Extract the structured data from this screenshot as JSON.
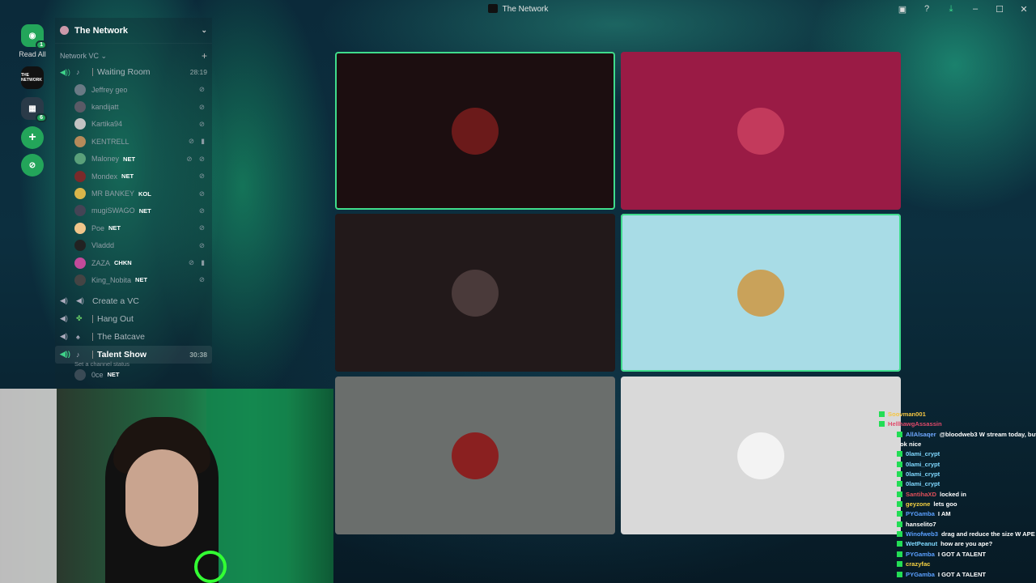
{
  "window": {
    "title": "The Network",
    "icons": [
      "pip-icon",
      "help-icon",
      "download-icon",
      "minimize-icon",
      "maximize-icon",
      "close-icon"
    ]
  },
  "rail": {
    "read_all": "Read All",
    "guild_badge": "1",
    "folder_badge": "6",
    "server_initials": "THE NETWORK"
  },
  "server": {
    "name": "The Network"
  },
  "category": {
    "name": "Network VC"
  },
  "channels": [
    {
      "name": "Waiting Room",
      "time": "28:19",
      "active": false
    },
    {
      "name": "Create a VC"
    },
    {
      "name": "Hang Out"
    },
    {
      "name": "The Batcave"
    },
    {
      "name": "Talent Show",
      "time": "30:38",
      "status": "Set a channel status"
    }
  ],
  "members": [
    {
      "name": "Jeffrey geo",
      "tag": "",
      "icons": "⊘"
    },
    {
      "name": "kandijatt",
      "tag": "",
      "icons": "⊘"
    },
    {
      "name": "Kartika94",
      "tag": "",
      "icons": "⊘"
    },
    {
      "name": "KENTRELL",
      "tag": "",
      "icons": "⊘ ▮"
    },
    {
      "name": "Maloney",
      "tag": "NET",
      "icons": "⊘ ⊘"
    },
    {
      "name": "Mondex",
      "tag": "NET",
      "icons": "⊘"
    },
    {
      "name": "MR BANKEY",
      "tag": "KOL",
      "icons": "⊘"
    },
    {
      "name": "mugiSWAGO",
      "tag": "NET",
      "icons": "⊘"
    },
    {
      "name": "Poe",
      "tag": "NET",
      "icons": "⊘"
    },
    {
      "name": "Vladdd",
      "tag": "",
      "icons": "⊘"
    },
    {
      "name": "ZAZA",
      "tag": "CHKN",
      "icons": "⊘ ▮"
    },
    {
      "name": "King_Nobita",
      "tag": "NET",
      "icons": "⊘"
    }
  ],
  "talent_member": {
    "name": "0ce",
    "tag": "NET"
  },
  "tiles": [
    {
      "bg": "#1c0e10",
      "pfp": "#6b1a1a",
      "speaking": true
    },
    {
      "bg": "#9a1b45",
      "pfp": "#c33a5c",
      "speaking": false
    },
    {
      "bg": "#22191a",
      "pfp": "#4a3a3a",
      "speaking": false
    },
    {
      "bg": "#a8dce6",
      "pfp": "#c9a25a",
      "speaking": true
    },
    {
      "bg": "#6a6e6c",
      "pfp": "#8a2020",
      "speaking": false
    },
    {
      "bg": "#d9d9d9",
      "pfp": "#f3f3f3",
      "speaking": false
    }
  ],
  "chat": [
    {
      "user": "Soovman001",
      "color": "#f5c542",
      "msg": ""
    },
    {
      "user": "HellhawgAssassin",
      "color": "#e04a6a",
      "msg": ""
    },
    {
      "user": "AllAlsaqer",
      "color": "#6fa8ff",
      "msg": "@bloodweb3 W stream today, but"
    },
    {
      "user": "",
      "color": "#fff",
      "msg": "ok nice"
    },
    {
      "user": "0lami_crypt",
      "color": "#7fd8ff",
      "msg": ""
    },
    {
      "user": "0lami_crypt",
      "color": "#7fd8ff",
      "msg": ""
    },
    {
      "user": "0lami_crypt",
      "color": "#7fd8ff",
      "msg": ""
    },
    {
      "user": "0lami_crypt",
      "color": "#7fd8ff",
      "msg": ""
    },
    {
      "user": "SantihaXD",
      "color": "#e0505a",
      "msg": "locked in"
    },
    {
      "user": "geyzone",
      "color": "#f5d142",
      "msg": "lets goo"
    },
    {
      "user": "PYGamba",
      "color": "#5aa0ff",
      "msg": "I AM"
    },
    {
      "user": "hanselito7",
      "color": "#ffffff",
      "msg": ""
    },
    {
      "user": "Winofweb3",
      "color": "#5aa0ff",
      "msg": "drag and reduce the size W APE"
    },
    {
      "user": "WetPeanut",
      "color": "#7fd8ff",
      "msg": "how are you ape?"
    },
    {
      "user": "PYGamba",
      "color": "#5aa0ff",
      "msg": "I GOT A TALENT"
    },
    {
      "user": "crazyfac",
      "color": "#f5d142",
      "msg": ""
    },
    {
      "user": "PYGamba",
      "color": "#5aa0ff",
      "msg": "I GOT A TALENT"
    }
  ]
}
